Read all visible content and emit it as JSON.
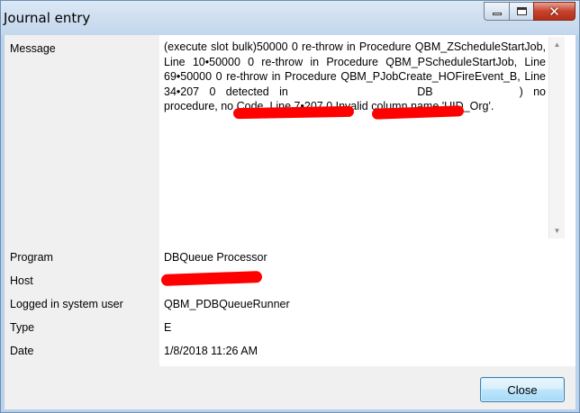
{
  "window": {
    "title": "Journal entry"
  },
  "caption": {
    "minimize_icon": "minimize-icon",
    "maximize_icon": "maximize-icon",
    "close_glyph": "✕"
  },
  "fields": {
    "message_label": "Message",
    "program_label": "Program",
    "host_label": "Host",
    "user_label": "Logged in system user",
    "type_label": "Type",
    "date_label": "Date"
  },
  "values": {
    "message_part1": "(execute slot bulk)50000        0             re-throw in Procedure QBM_ZScheduleStartJob, Line 10•50000             0             re-throw in Procedure QBM_PScheduleStartJob, Line 69•50000             0             re-throw in Procedure QBM_PJobCreate_HOFireEvent_B, Line 34•207    0     detected in ",
    "message_part2": "DB",
    "message_part3": ") no procedure, no Code, Line 7•207             0             Invalid column name 'UID_Org'.",
    "program": "DBQueue Processor",
    "host": "",
    "user": "QBM_PDBQueueRunner",
    "type": "E",
    "date": "1/8/2018 11:26 AM"
  },
  "buttons": {
    "close_label": "Close"
  },
  "colors": {
    "redaction": "#ff0000",
    "titlebar": "#c3d6ec"
  }
}
